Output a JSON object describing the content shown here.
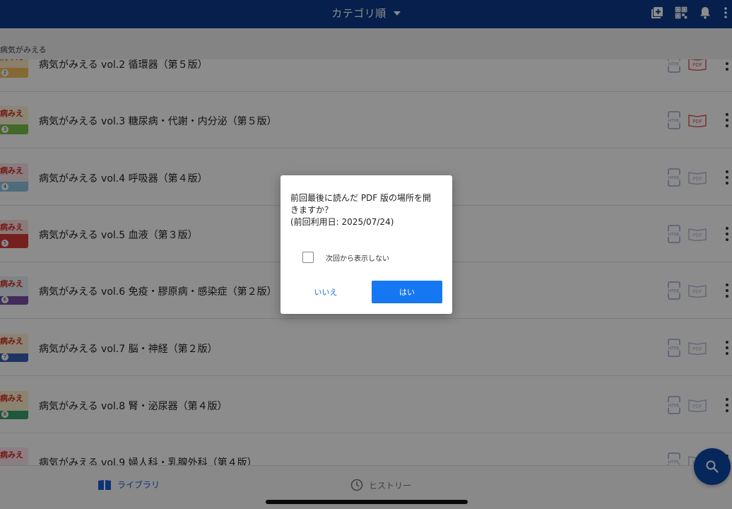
{
  "topbar": {
    "title": "カテゴリ順",
    "icons": [
      "add-box-icon",
      "qr-code-icon",
      "bell-icon",
      "more-vert-icon"
    ]
  },
  "section": {
    "header": "病気がみえる"
  },
  "books": [
    {
      "title": "病気がみえる vol.2 循環器（第５版）",
      "number": "2",
      "has_pdf": true,
      "pdf_color": "#e05a5a",
      "cover_color": "#f0c060"
    },
    {
      "title": "病気がみえる vol.3 糖尿病・代謝・内分泌（第５版）",
      "number": "3",
      "has_pdf": true,
      "pdf_color": "#e05a5a",
      "cover_color": "#7bbf4a"
    },
    {
      "title": "病気がみえる vol.4 呼吸器（第４版）",
      "number": "4",
      "has_pdf": false,
      "pdf_color": "#b8bcd8",
      "cover_color": "#8ec5e0"
    },
    {
      "title": "病気がみえる vol.5 血液（第３版）",
      "number": "5",
      "has_pdf": false,
      "pdf_color": "#b8bcd8",
      "cover_color": "#d83a3a"
    },
    {
      "title": "病気がみえる vol.6 免疫・膠原病・感染症（第２版）",
      "number": "6",
      "has_pdf": false,
      "pdf_color": "#b8bcd8",
      "cover_color": "#7a4fa8"
    },
    {
      "title": "病気がみえる vol.7 脳・神経（第２版）",
      "number": "7",
      "has_pdf": false,
      "pdf_color": "#b8bcd8",
      "cover_color": "#3a5fb8"
    },
    {
      "title": "病気がみえる vol.8 腎・泌尿器（第４版）",
      "number": "8",
      "has_pdf": false,
      "pdf_color": "#b8bcd8",
      "cover_color": "#3aa06a"
    },
    {
      "title": "病気がみえる vol.9 婦人科・乳腺外科（第４版）",
      "number": "9",
      "has_pdf": false,
      "pdf_color": "#b8bcd8",
      "cover_color": "#e07aa0"
    }
  ],
  "book_brand": "病みえ",
  "html_label": "HTML",
  "pdf_label": "PDF",
  "bottom_nav": {
    "library": "ライブラリ",
    "history": "ヒストリー"
  },
  "dialog": {
    "message_line1": "前回最後に読んだ PDF 版の場所を開",
    "message_line2": "きますか？",
    "message_line3": "(前回利用日: 2025/07/24)",
    "checkbox_label": "次回から表示しない",
    "checkbox_checked": false,
    "no_label": "いいえ",
    "yes_label": "はい"
  },
  "colors": {
    "topbar": "#0b3a8a",
    "primary_button": "#1677f2",
    "link": "#1a6fd6",
    "fab": "#0b47a8"
  }
}
